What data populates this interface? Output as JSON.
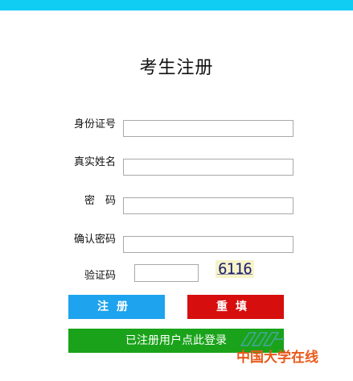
{
  "page": {
    "title": "考生注册"
  },
  "form": {
    "fields": [
      {
        "label": "身份证号",
        "value": ""
      },
      {
        "label": "真实姓名",
        "value": ""
      },
      {
        "label": "密　码",
        "value": ""
      },
      {
        "label": "确认密码",
        "value": ""
      }
    ],
    "captcha": {
      "label": "验证码",
      "value": "",
      "image_text": "6116"
    }
  },
  "buttons": {
    "register": "注册",
    "reset": "重填",
    "login": "已注册用户点此登录"
  },
  "watermark": {
    "text": "中国大学在线"
  },
  "colors": {
    "topbar": "#10cdf3",
    "register": "#1ea3ee",
    "reset": "#d70e0e",
    "login": "#1aa31a",
    "watermark": "#e85a1c"
  }
}
